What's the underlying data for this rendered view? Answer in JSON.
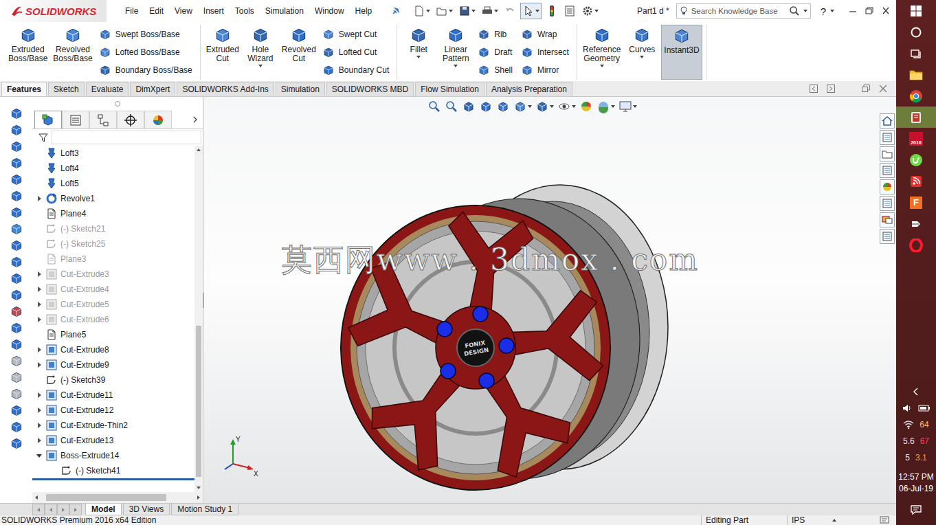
{
  "window": {
    "app_name": "SOLIDWORKS",
    "document": "Part1 d *",
    "help": "?"
  },
  "menu": [
    "File",
    "Edit",
    "View",
    "Insert",
    "Tools",
    "Simulation",
    "Window",
    "Help"
  ],
  "search": {
    "placeholder": "Search Knowledge Base"
  },
  "ribbon_groups": [
    {
      "commands": [
        {
          "kind": "large",
          "label": "Extruded Boss/Base",
          "dropdown": false,
          "selected": false
        },
        {
          "kind": "large",
          "label": "Revolved Boss/Base",
          "dropdown": false,
          "selected": false
        },
        {
          "kind": "stack",
          "items": [
            {
              "label": "Swept Boss/Base",
              "selected": false
            },
            {
              "label": "Lofted Boss/Base",
              "selected": false
            },
            {
              "label": "Boundary Boss/Base",
              "selected": false
            }
          ]
        }
      ]
    },
    {
      "commands": [
        {
          "kind": "large",
          "label": "Extruded Cut",
          "dropdown": false,
          "selected": false
        },
        {
          "kind": "large",
          "label": "Hole Wizard",
          "dropdown": true,
          "selected": false
        },
        {
          "kind": "large",
          "label": "Revolved Cut",
          "dropdown": false,
          "selected": false
        },
        {
          "kind": "stack",
          "items": [
            {
              "label": "Swept Cut",
              "selected": false
            },
            {
              "label": "Lofted Cut",
              "selected": false
            },
            {
              "label": "Boundary Cut",
              "selected": false
            }
          ]
        }
      ]
    },
    {
      "commands": [
        {
          "kind": "large",
          "label": "Fillet",
          "dropdown": true,
          "selected": false
        },
        {
          "kind": "large",
          "label": "Linear Pattern",
          "dropdown": true,
          "selected": false
        },
        {
          "kind": "stack",
          "items": [
            {
              "label": "Rib",
              "selected": false
            },
            {
              "label": "Draft",
              "selected": false
            },
            {
              "label": "Shell",
              "selected": false
            }
          ]
        },
        {
          "kind": "stack",
          "items": [
            {
              "label": "Wrap",
              "selected": false
            },
            {
              "label": "Intersect",
              "selected": false
            },
            {
              "label": "Mirror",
              "selected": false
            }
          ]
        }
      ]
    },
    {
      "commands": [
        {
          "kind": "large",
          "label": "Reference Geometry",
          "dropdown": true,
          "selected": false
        },
        {
          "kind": "large",
          "label": "Curves",
          "dropdown": true,
          "selected": false
        },
        {
          "kind": "large",
          "label": "Instant3D",
          "dropdown": false,
          "selected": true
        }
      ]
    }
  ],
  "command_tabs": [
    {
      "label": "Features",
      "selected": true
    },
    {
      "label": "Sketch",
      "selected": false
    },
    {
      "label": "Evaluate",
      "selected": false
    },
    {
      "label": "DimXpert",
      "selected": false
    },
    {
      "label": "SOLIDWORKS Add-Ins",
      "selected": false
    },
    {
      "label": "Simulation",
      "selected": false
    },
    {
      "label": "SOLIDWORKS MBD",
      "selected": false
    },
    {
      "label": "Flow Simulation",
      "selected": false
    },
    {
      "label": "Analysis Preparation",
      "selected": false
    }
  ],
  "panel_tabs": [
    {
      "kind": "feature-manager",
      "selected": true
    },
    {
      "kind": "property-manager",
      "selected": false
    },
    {
      "kind": "configuration-manager",
      "selected": false
    },
    {
      "kind": "dimxpert-manager",
      "selected": false
    },
    {
      "kind": "display-manager",
      "selected": false
    }
  ],
  "feature_tree": [
    {
      "label": "Loft3",
      "kind": "loft",
      "suppressed": false,
      "expandable": false,
      "expanded": false,
      "depth": 0
    },
    {
      "label": "Loft4",
      "kind": "loft",
      "suppressed": false,
      "expandable": false,
      "expanded": false,
      "depth": 0
    },
    {
      "label": "Loft5",
      "kind": "loft",
      "suppressed": false,
      "expandable": false,
      "expanded": false,
      "depth": 0
    },
    {
      "label": "Revolve1",
      "kind": "revolve",
      "suppressed": false,
      "expandable": true,
      "expanded": false,
      "depth": 0
    },
    {
      "label": "Plane4",
      "kind": "plane",
      "suppressed": false,
      "expandable": false,
      "expanded": false,
      "depth": 0
    },
    {
      "label": "(-) Sketch21",
      "kind": "sketch",
      "suppressed": true,
      "expandable": false,
      "expanded": false,
      "depth": 0
    },
    {
      "label": "(-) Sketch25",
      "kind": "sketch",
      "suppressed": true,
      "expandable": false,
      "expanded": false,
      "depth": 0
    },
    {
      "label": "Plane3",
      "kind": "plane",
      "suppressed": true,
      "expandable": false,
      "expanded": false,
      "depth": 0
    },
    {
      "label": "Cut-Extrude3",
      "kind": "cut",
      "suppressed": true,
      "expandable": true,
      "expanded": false,
      "depth": 0
    },
    {
      "label": "Cut-Extrude4",
      "kind": "cut",
      "suppressed": true,
      "expandable": true,
      "expanded": false,
      "depth": 0
    },
    {
      "label": "Cut-Extrude5",
      "kind": "cut",
      "suppressed": true,
      "expandable": true,
      "expanded": false,
      "depth": 0
    },
    {
      "label": "Cut-Extrude6",
      "kind": "cut",
      "suppressed": true,
      "expandable": true,
      "expanded": false,
      "depth": 0
    },
    {
      "label": "Plane5",
      "kind": "plane",
      "suppressed": false,
      "expandable": false,
      "expanded": false,
      "depth": 0
    },
    {
      "label": "Cut-Extrude8",
      "kind": "cut",
      "suppressed": false,
      "expandable": true,
      "expanded": false,
      "depth": 0
    },
    {
      "label": "Cut-Extrude9",
      "kind": "cut",
      "suppressed": false,
      "expandable": true,
      "expanded": false,
      "depth": 0
    },
    {
      "label": "(-) Sketch39",
      "kind": "sketch",
      "suppressed": false,
      "expandable": false,
      "expanded": false,
      "depth": 0
    },
    {
      "label": "Cut-Extrude11",
      "kind": "cut",
      "suppressed": false,
      "expandable": true,
      "expanded": false,
      "depth": 0
    },
    {
      "label": "Cut-Extrude12",
      "kind": "cut",
      "suppressed": false,
      "expandable": true,
      "expanded": false,
      "depth": 0
    },
    {
      "label": "Cut-Extrude-Thin2",
      "kind": "cut",
      "suppressed": false,
      "expandable": true,
      "expanded": false,
      "depth": 0
    },
    {
      "label": "Cut-Extrude13",
      "kind": "cut",
      "suppressed": false,
      "expandable": true,
      "expanded": false,
      "depth": 0
    },
    {
      "label": "Boss-Extrude14",
      "kind": "boss",
      "suppressed": false,
      "expandable": true,
      "expanded": true,
      "depth": 0
    },
    {
      "label": "(-) Sketch41",
      "kind": "sketch",
      "suppressed": false,
      "expandable": false,
      "expanded": false,
      "depth": 1
    }
  ],
  "graphics": {
    "watermark": "莫西网www．3dmox．com",
    "hub_text": [
      "FONIX",
      "DESIGN"
    ],
    "triad": {
      "x": "X",
      "y": "Y"
    }
  },
  "bottom_tabs": [
    {
      "label": "Model",
      "selected": true
    },
    {
      "label": "3D Views",
      "selected": false
    },
    {
      "label": "Motion Study 1",
      "selected": false
    }
  ],
  "status_bar": {
    "edition": "SOLIDWORKS Premium 2016 x64 Edition",
    "mode": "Editing Part",
    "units": "IPS"
  },
  "taskbar": {
    "apps": [
      {
        "kind": "start",
        "active": false
      },
      {
        "kind": "search",
        "active": false
      },
      {
        "kind": "task-view",
        "active": false
      },
      {
        "kind": "explorer",
        "active": false
      },
      {
        "kind": "chrome",
        "active": false
      },
      {
        "kind": "app-red",
        "active": true
      },
      {
        "kind": "solidworks",
        "active": false,
        "label": "2016"
      },
      {
        "kind": "upwork",
        "active": false
      },
      {
        "kind": "rss",
        "active": false
      },
      {
        "kind": "foxit",
        "active": false,
        "label": "F"
      },
      {
        "kind": "usb",
        "active": false
      },
      {
        "kind": "opera",
        "active": false
      }
    ],
    "tray_rows": [
      {
        "kind": "wifi",
        "values": [
          {
            "text": "64",
            "color": "#f2c14e"
          }
        ]
      },
      {
        "kind": "plain",
        "values": [
          {
            "text": "5.6",
            "color": "#e6e6e6"
          },
          {
            "text": "67",
            "color": "#ff3d6e"
          }
        ]
      },
      {
        "kind": "plain",
        "values": [
          {
            "text": "5",
            "color": "#e6e6e6"
          },
          {
            "text": "3.1",
            "color": "#f0a020"
          }
        ]
      }
    ],
    "time": "12:57 PM",
    "date": "06-Jul-19"
  }
}
